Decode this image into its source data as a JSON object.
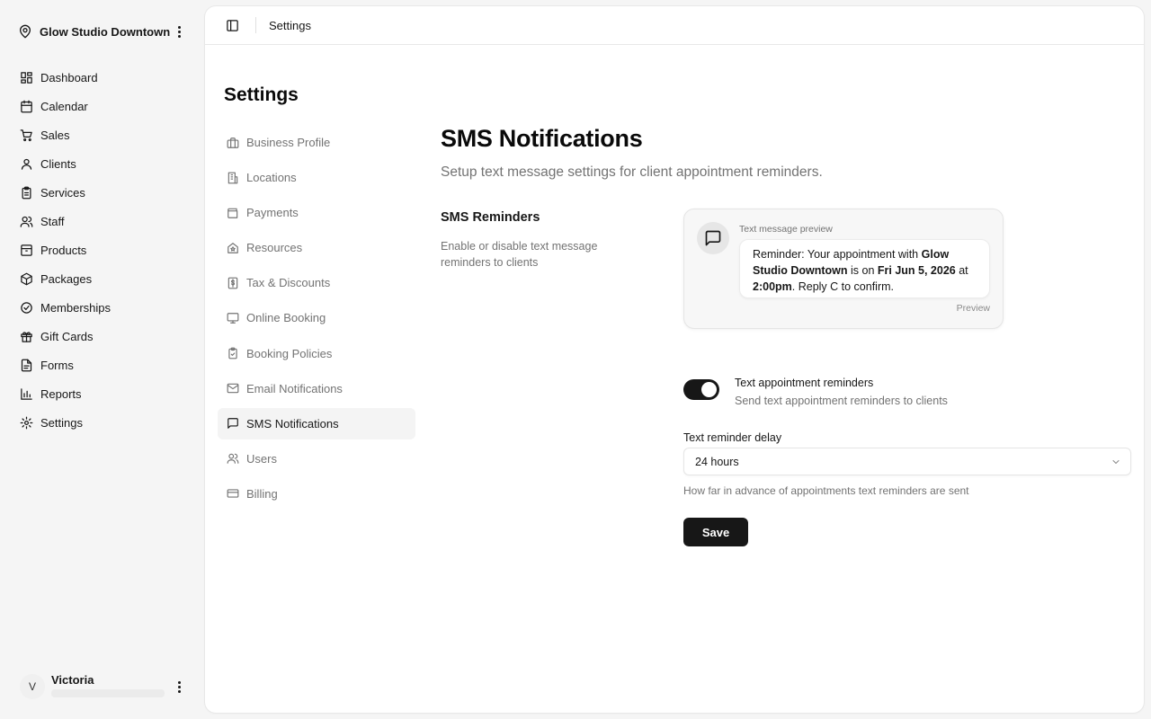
{
  "location": {
    "name": "Glow Studio Downtown",
    "icon": "map-pin-icon"
  },
  "nav": [
    {
      "label": "Dashboard",
      "icon": "dashboard-icon"
    },
    {
      "label": "Calendar",
      "icon": "calendar-icon"
    },
    {
      "label": "Sales",
      "icon": "cart-icon"
    },
    {
      "label": "Clients",
      "icon": "user-icon"
    },
    {
      "label": "Services",
      "icon": "clipboard-icon"
    },
    {
      "label": "Staff",
      "icon": "users-icon"
    },
    {
      "label": "Products",
      "icon": "box-icon"
    },
    {
      "label": "Packages",
      "icon": "package-icon"
    },
    {
      "label": "Memberships",
      "icon": "badge-check-icon"
    },
    {
      "label": "Gift Cards",
      "icon": "gift-icon"
    },
    {
      "label": "Forms",
      "icon": "file-text-icon"
    },
    {
      "label": "Reports",
      "icon": "bar-chart-icon"
    },
    {
      "label": "Settings",
      "icon": "gear-icon"
    }
  ],
  "user": {
    "initial": "V",
    "name": "Victoria"
  },
  "header": {
    "breadcrumb": "Settings"
  },
  "settings": {
    "title": "Settings",
    "sections": [
      {
        "label": "Business Profile",
        "icon": "briefcase-icon"
      },
      {
        "label": "Locations",
        "icon": "building-icon"
      },
      {
        "label": "Payments",
        "icon": "wallet-icon"
      },
      {
        "label": "Resources",
        "icon": "house-star-icon"
      },
      {
        "label": "Tax & Discounts",
        "icon": "receipt-icon"
      },
      {
        "label": "Online Booking",
        "icon": "monitor-icon"
      },
      {
        "label": "Booking Policies",
        "icon": "clipboard-check-icon"
      },
      {
        "label": "Email Notifications",
        "icon": "mail-icon"
      },
      {
        "label": "SMS Notifications",
        "icon": "message-square-icon"
      },
      {
        "label": "Users",
        "icon": "users-icon"
      },
      {
        "label": "Billing",
        "icon": "credit-card-icon"
      }
    ],
    "active_section": "SMS Notifications"
  },
  "page": {
    "title": "SMS Notifications",
    "description": "Setup text message settings for client appointment reminders."
  },
  "reminders": {
    "title": "SMS Reminders",
    "description": "Enable or disable text message reminders to clients",
    "preview": {
      "label": "Text message preview",
      "msg": {
        "t1": "Reminder: Your appointment with ",
        "b1": "Glow Studio Downtown",
        "t2": " is on ",
        "b2": "Fri Jun 5, 2026",
        "t3": " at ",
        "b3": "2:00pm",
        "t4": ". Reply C to confirm."
      },
      "tag": "Preview"
    },
    "toggle": {
      "title": "Text appointment reminders",
      "description": "Send text appointment reminders to clients",
      "enabled": true
    },
    "delay": {
      "label": "Text reminder delay",
      "value": "24 hours",
      "hint": "How far in advance of appointments text reminders are sent"
    },
    "save_label": "Save"
  },
  "colors": {
    "accent": "#171717",
    "muted": "#737373",
    "active_bg": "#f4f4f4",
    "page_bg": "#f5f5f5"
  }
}
